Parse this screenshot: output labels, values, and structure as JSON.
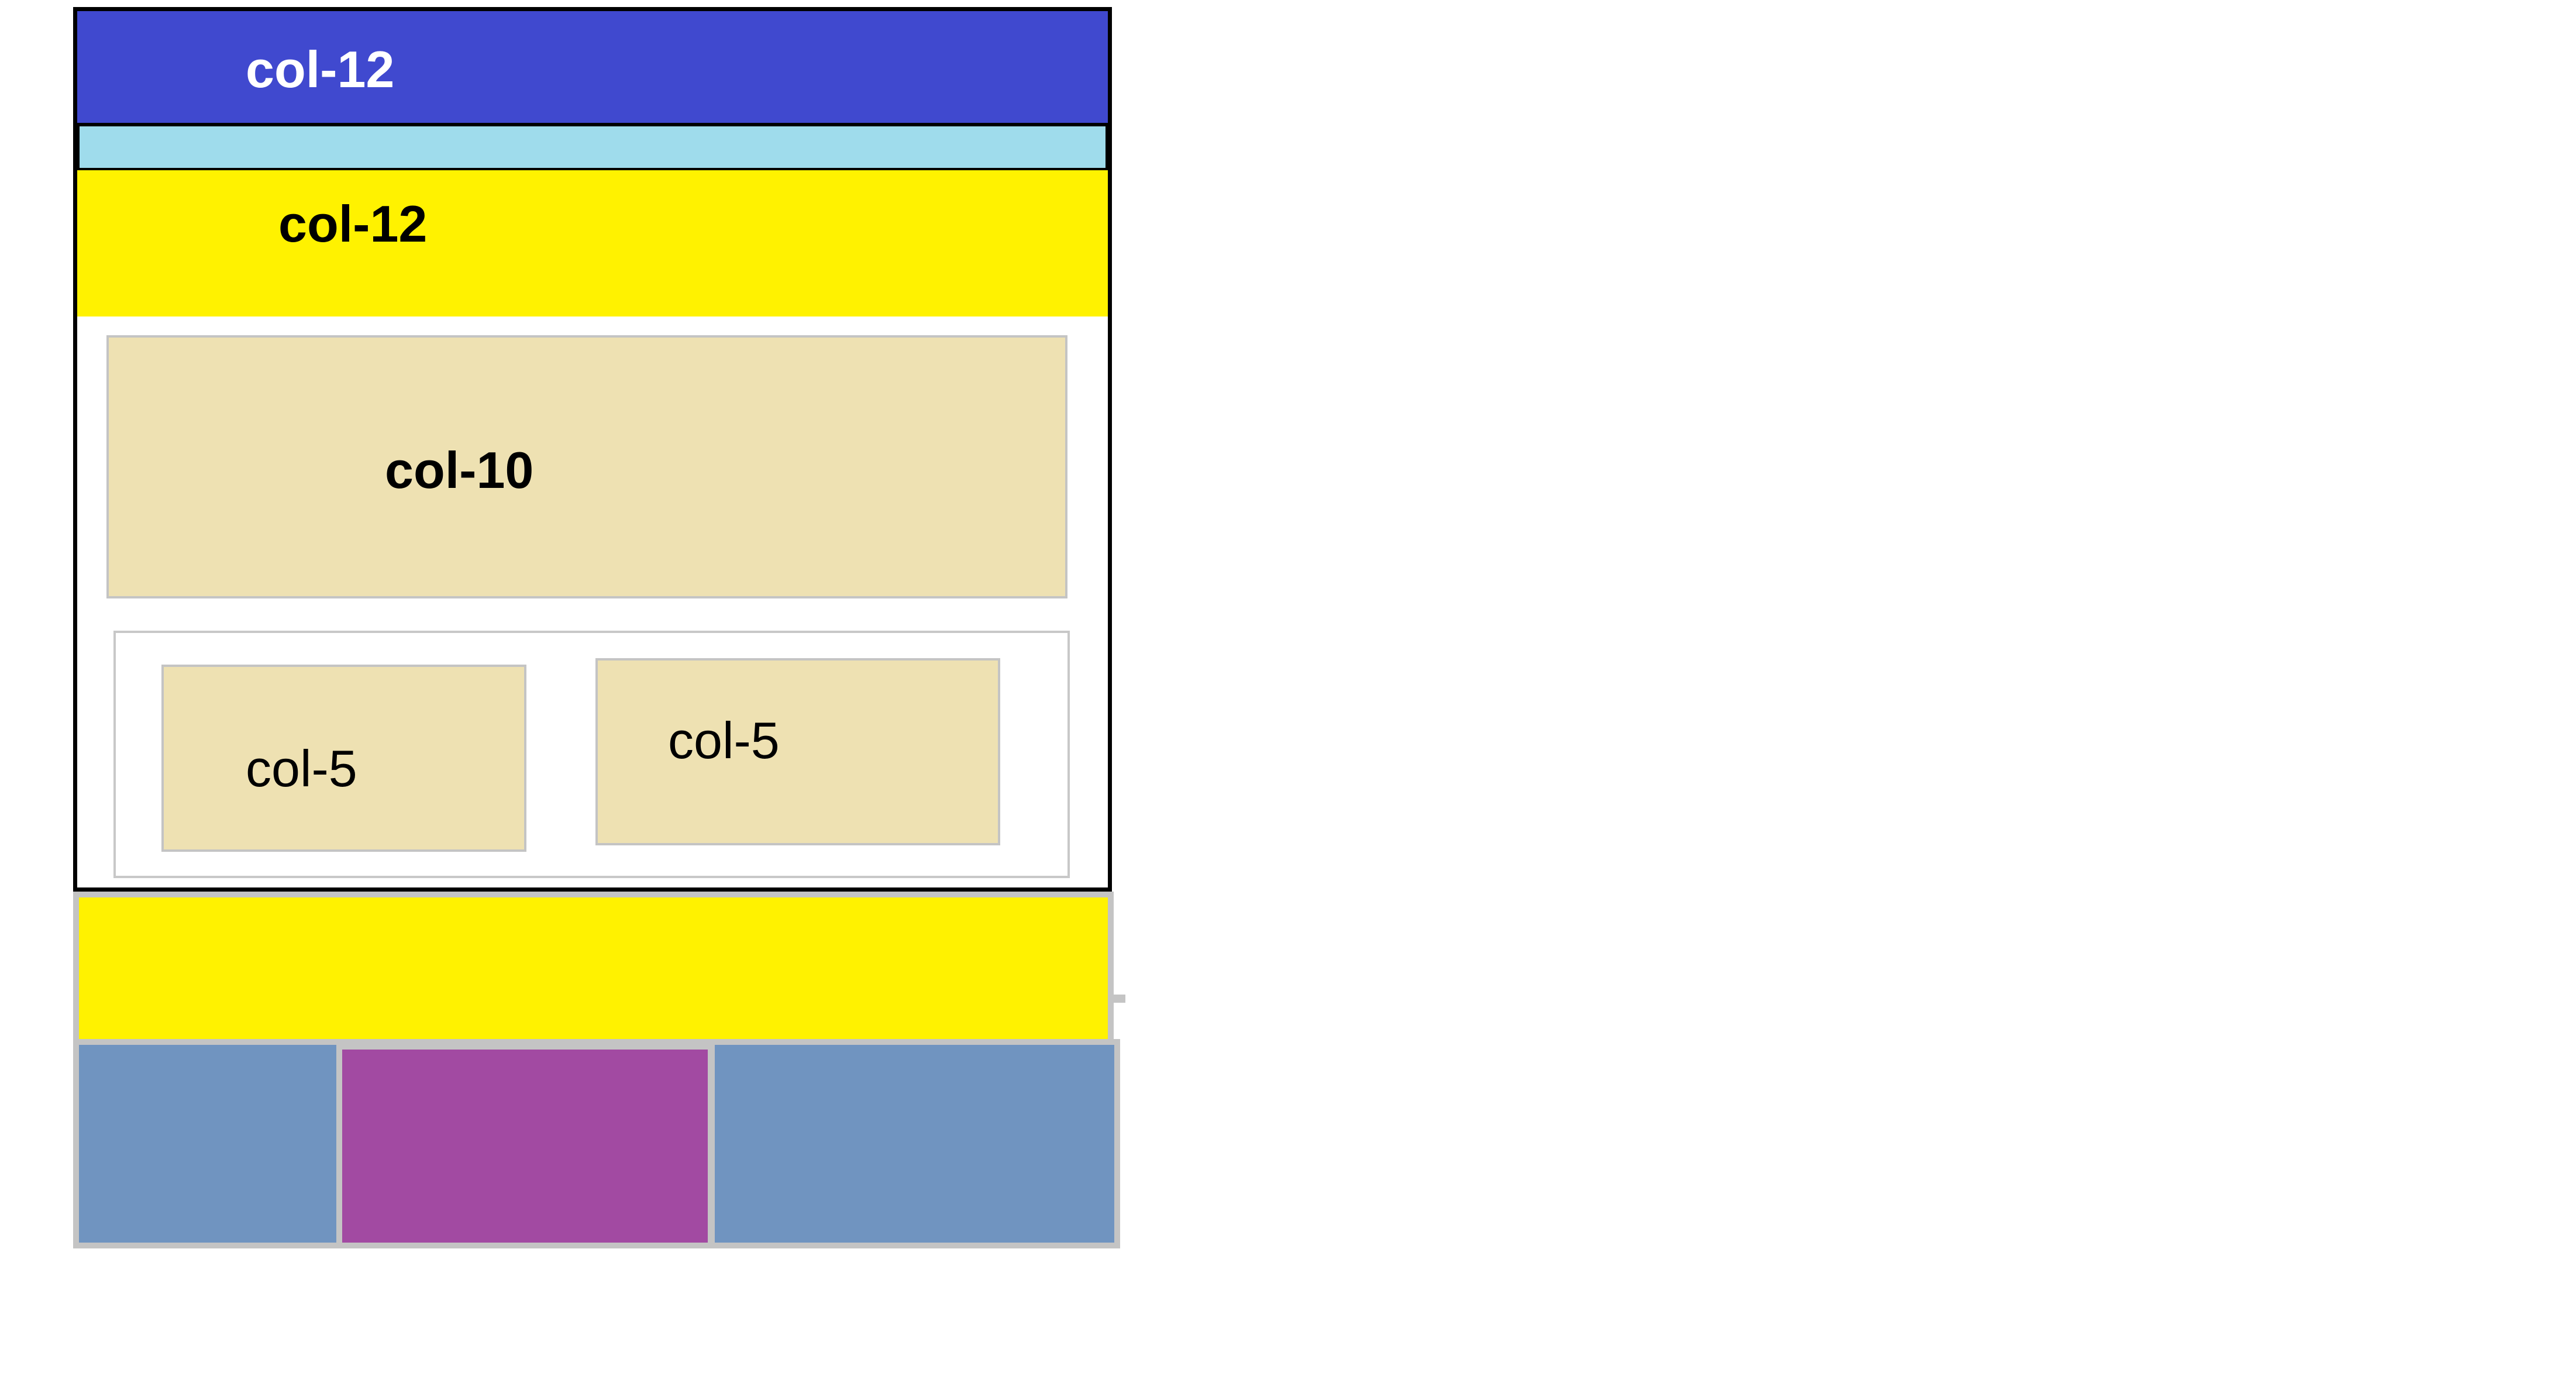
{
  "diagram": {
    "header": {
      "label": "col-12",
      "color": "#4049cf",
      "text_color": "#ffffff"
    },
    "strip": {
      "color": "#9fdcec"
    },
    "band": {
      "label": "col-12",
      "color": "#fff200"
    },
    "col10": {
      "label": "col-10",
      "color": "#eee1b2"
    },
    "row": {
      "left": {
        "label": "col-5",
        "color": "#eee1b2"
      },
      "right": {
        "label": "col-5",
        "color": "#eee1b2"
      }
    },
    "footer": {
      "color": "#fff200"
    },
    "bottom_cells": [
      {
        "color": "#7094c0"
      },
      {
        "color": "#a24aa2"
      },
      {
        "color": "#7094c0"
      }
    ]
  }
}
